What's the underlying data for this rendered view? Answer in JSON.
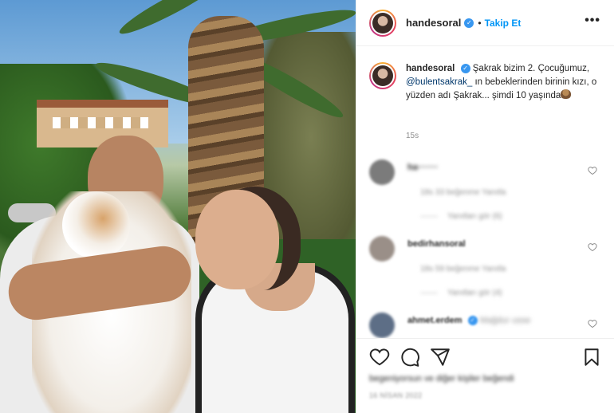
{
  "post": {
    "username": "handesoral",
    "follow_label": "Takip Et",
    "dot": "•",
    "more_label": "•••"
  },
  "caption": {
    "username": "handesoral",
    "text_before_mention": "Şakrak bizim 2. Çocuğumuz,",
    "mention": "@bulentsakrak_",
    "text_after_mention": "ın bebeklerinden birinin kızı, o yüzden adı Şakrak... şimdi 10 yaşında",
    "time": "15s"
  },
  "comments": [
    {
      "username": "ha·······",
      "meta": "18s    33 beğenme    Yanıtla",
      "replies": "Yanıtları gör (6)"
    },
    {
      "username": "bedirhansoral",
      "meta": "18s    59 beğenme    Yanıtla",
      "replies": "Yanıtları gör (4)"
    },
    {
      "username": "ahmet.erdem",
      "inline": "Mağdur usse",
      "meta": "",
      "replies": ""
    }
  ],
  "footer": {
    "likes": "begeniyorsun ve diğer kişiler beğendi",
    "date": "16 NİSAN 2022"
  },
  "icons": [
    "heart-icon",
    "comment-icon",
    "share-icon",
    "bookmark-icon",
    "verified-icon",
    "more-icon"
  ],
  "colors": {
    "accent": "#0095f6",
    "verified": "#3897f0",
    "text": "#262626",
    "muted": "#8e8e8e"
  }
}
